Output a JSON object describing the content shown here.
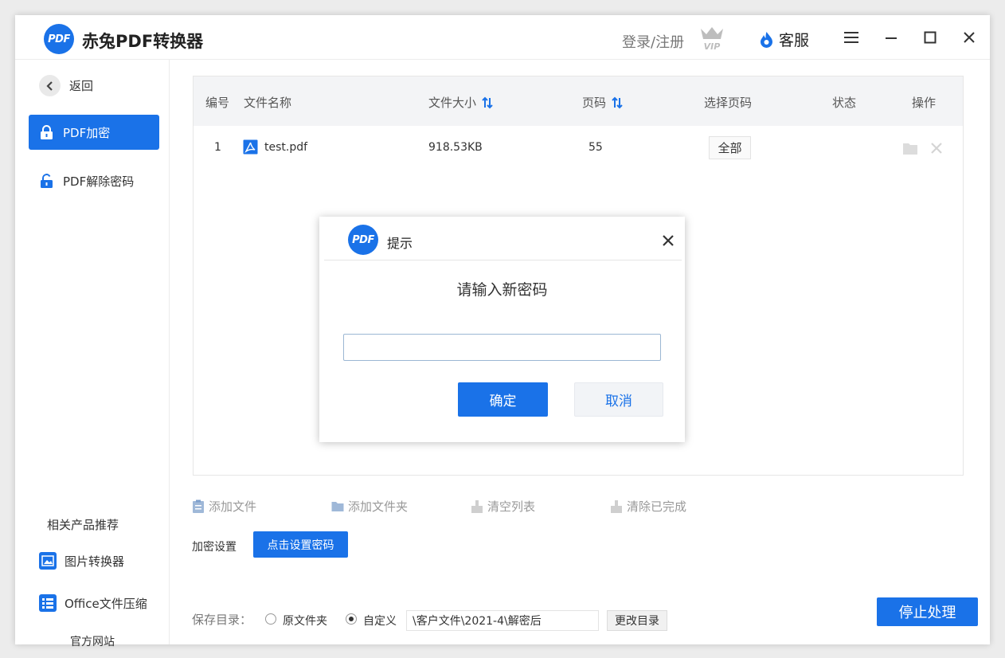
{
  "app": {
    "logo_text": "PDF",
    "title": "赤兔PDF转换器",
    "login_label": "登录/注册",
    "vip_label": "VIP",
    "service_label": "客服"
  },
  "sidebar": {
    "back_label": "返回",
    "items": [
      {
        "label": "PDF加密",
        "active": true
      },
      {
        "label": "PDF解除密码",
        "active": false
      }
    ],
    "recommend_title": "相关产品推荐",
    "recommend_items": [
      {
        "label": "图片转换器"
      },
      {
        "label": "Office文件压缩"
      }
    ],
    "official_site": "官方网站"
  },
  "table": {
    "headers": {
      "index": "编号",
      "name": "文件名称",
      "size": "文件大小",
      "pages": "页码",
      "select_pages": "选择页码",
      "status": "状态",
      "actions": "操作"
    },
    "rows": [
      {
        "index": "1",
        "name": "test.pdf",
        "size": "918.53KB",
        "pages": "55",
        "select_pages": "全部",
        "status": ""
      }
    ]
  },
  "toolbar": {
    "add_file": "添加文件",
    "add_folder": "添加文件夹",
    "clear_list": "清空列表",
    "clear_done": "清除已完成"
  },
  "encrypt": {
    "label": "加密设置",
    "button": "点击设置密码"
  },
  "save": {
    "label": "保存目录：",
    "option_original": "原文件夹",
    "option_custom": "自定义",
    "selected": "自定义",
    "path": "\\客户文件\\2021-4\\解密后",
    "change_button": "更改目录",
    "stop_button": "停止处理"
  },
  "dialog": {
    "logo_text": "PDF",
    "title": "提示",
    "message": "请输入新密码",
    "input_value": "",
    "ok": "确定",
    "cancel": "取消"
  },
  "colors": {
    "accent": "#1a72e8"
  }
}
